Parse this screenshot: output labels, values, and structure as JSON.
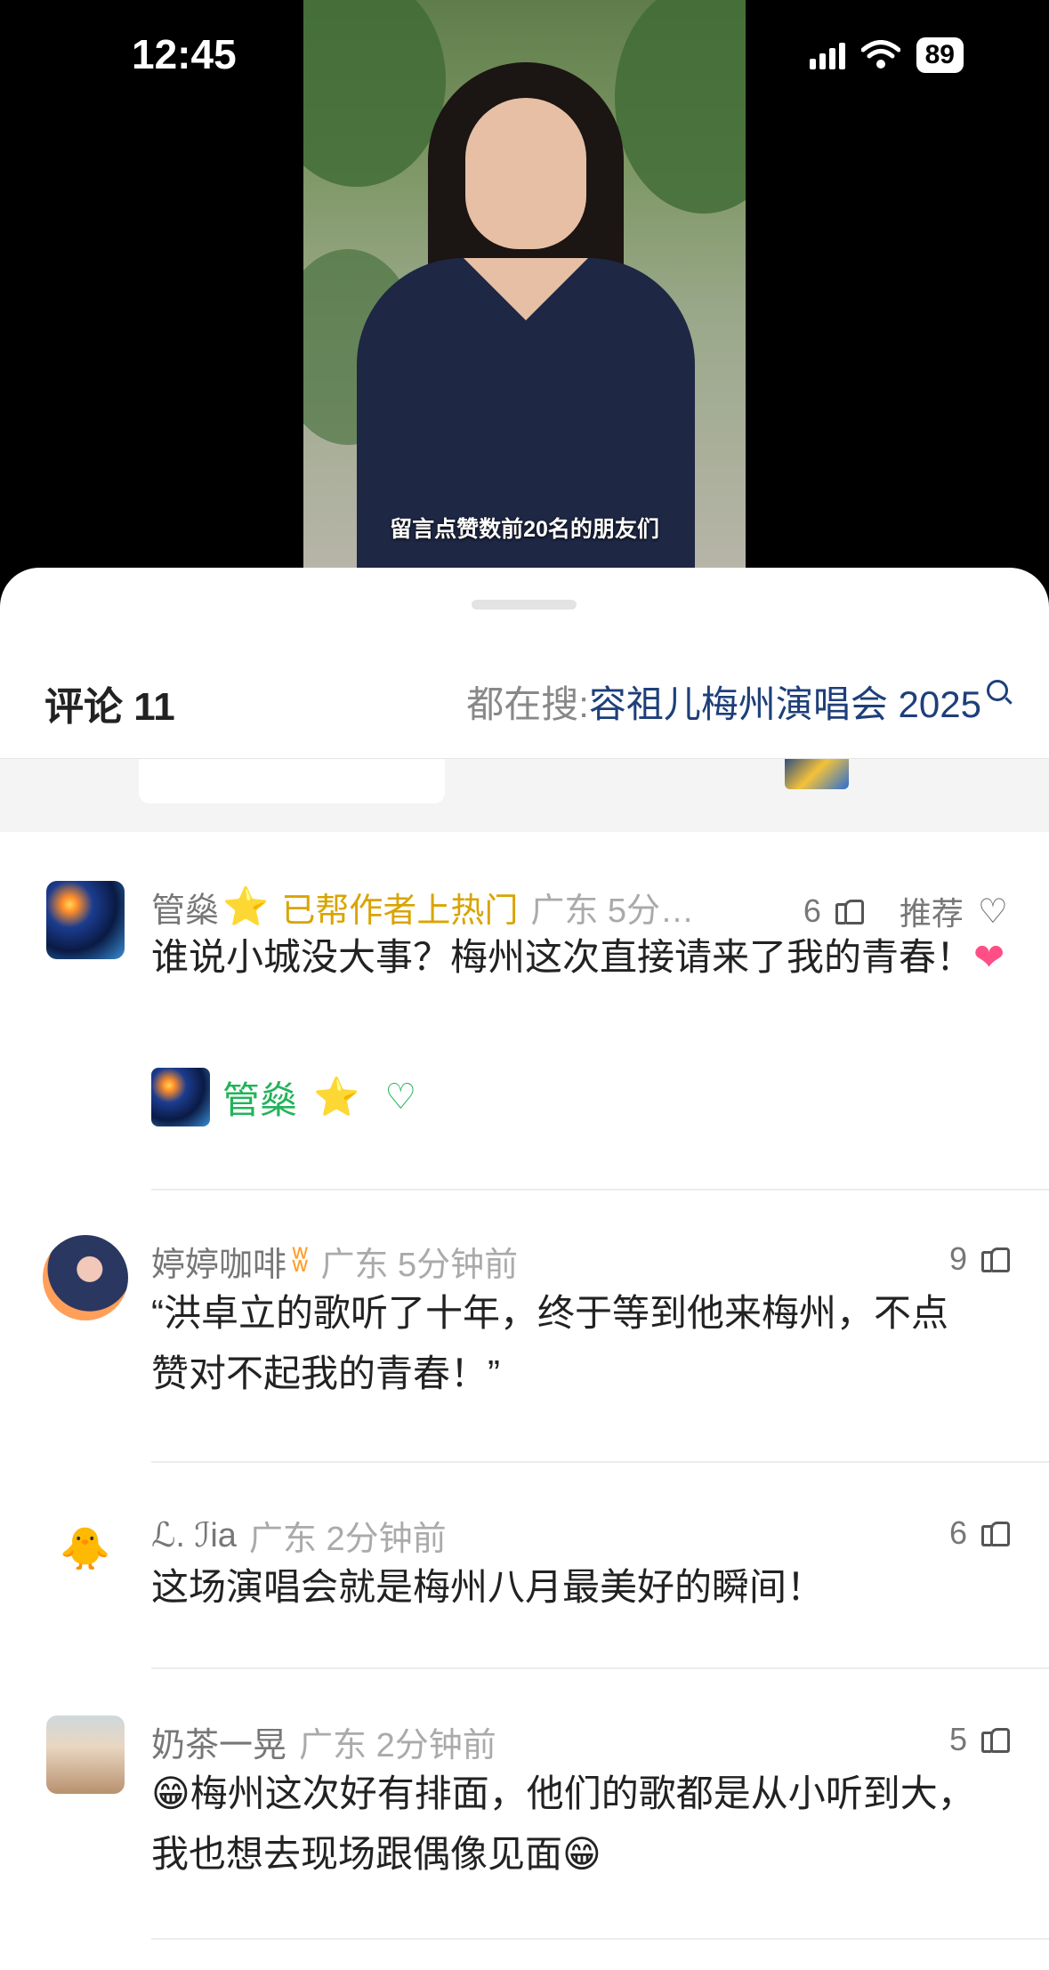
{
  "status_bar": {
    "time": "12:45",
    "battery": "89"
  },
  "video": {
    "subtitle": "留言点赞数前20名的朋友们"
  },
  "comments_header": {
    "title": "评论 11",
    "search_prefix": "都在搜:",
    "search_term": "容祖儿梅州演唱会 2025"
  },
  "comments": [
    {
      "name": "管燊",
      "badge": "⭐",
      "helped": "已帮作者上热门",
      "region_time": "广东 5分…",
      "likes": "6",
      "extra": "推荐",
      "text": "谁说小城没大事？梅州这次直接请来了我的青春！",
      "reply_name": "管燊",
      "reply_badge": "⭐"
    },
    {
      "name": "婷婷咖啡",
      "vip": "ʬ",
      "region_time": "广东 5分钟前",
      "likes": "9",
      "text": "“洪卓立的歌听了十年，终于等到他来梅州，不点赞对不起我的青春！”"
    },
    {
      "name": "ℒ. ℐia",
      "region_time": "广东 2分钟前",
      "likes": "6",
      "text": "这场演唱会就是梅州八月最美好的瞬间！"
    },
    {
      "name": "奶茶一晃",
      "region_time": "广东 2分钟前",
      "likes": "5",
      "text": "😁梅州这次好有排面，他们的歌都是从小听到大，我也想去现场跟偶像见面😁"
    }
  ]
}
